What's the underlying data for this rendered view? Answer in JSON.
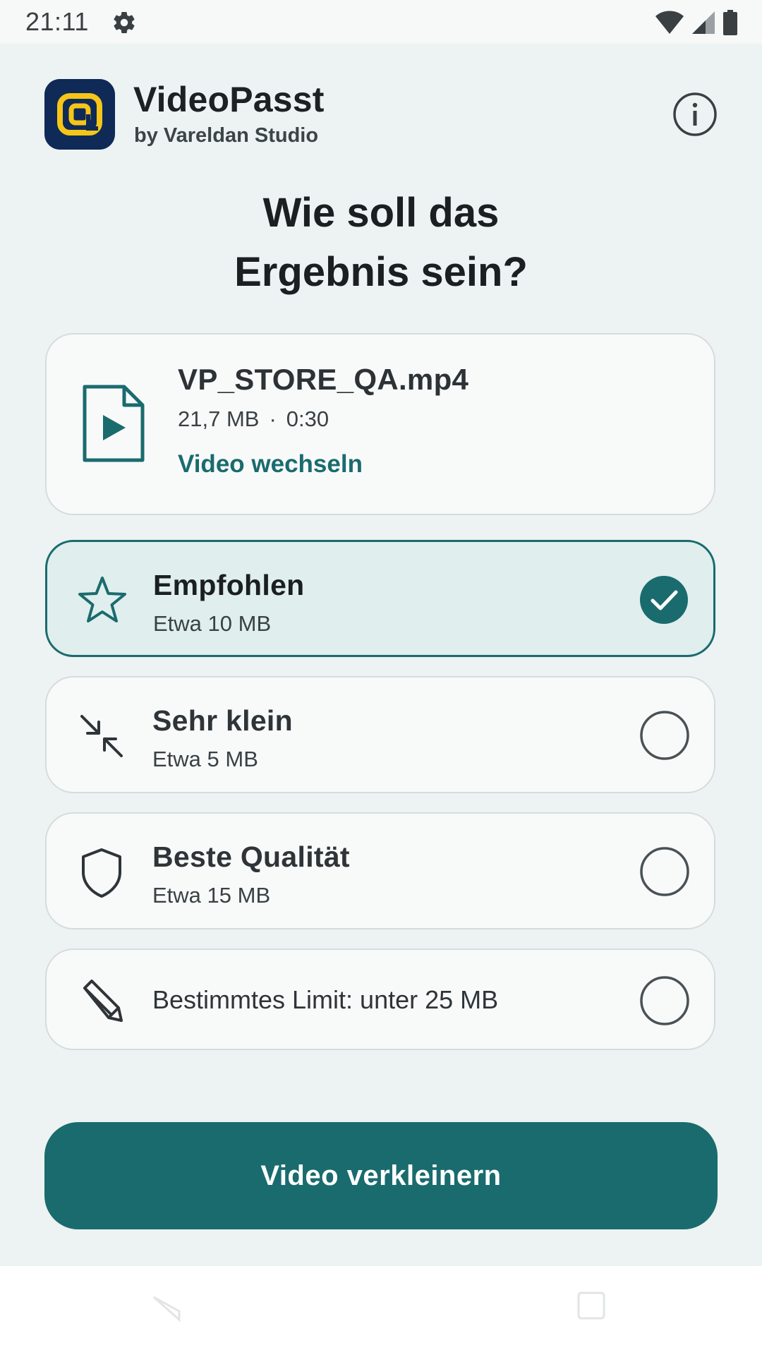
{
  "status_bar": {
    "time": "21:11",
    "settings_icon": "gear-icon",
    "wifi_icon": "wifi-icon",
    "signal_icon": "signal-icon",
    "battery_icon": "battery-icon"
  },
  "header": {
    "app_name": "VideoPasst",
    "subtitle": "by Vareldan Studio",
    "logo_icon": "app-logo-icon",
    "info_icon": "info-icon"
  },
  "question": {
    "line1": "Wie soll das",
    "line2": "Ergebnis sein?"
  },
  "file": {
    "name": "VP_STORE_QA.mp4",
    "size": "21,7 MB",
    "separator": "·",
    "duration": "0:30",
    "change_label": "Video wechseln"
  },
  "options": [
    {
      "title": "Empfohlen",
      "subtitle": "Etwa 10 MB",
      "icon": "star-icon",
      "selected": true
    },
    {
      "title": "Sehr klein",
      "subtitle": "Etwa 5 MB",
      "icon": "compress-arrows-icon",
      "selected": false
    },
    {
      "title": "Beste Qualität",
      "subtitle": "Etwa 15 MB",
      "icon": "shield-icon",
      "selected": false
    }
  ],
  "limit_option": {
    "label": "Bestimmtes Limit: unter 25 MB",
    "icon": "pencil-icon",
    "selected": false
  },
  "primary_button": {
    "label": "Video verkleinern"
  },
  "colors": {
    "accent": "#196b6e",
    "logo_bg": "#0f2a57",
    "logo_fg": "#f5c518",
    "background": "#edf2f2"
  }
}
